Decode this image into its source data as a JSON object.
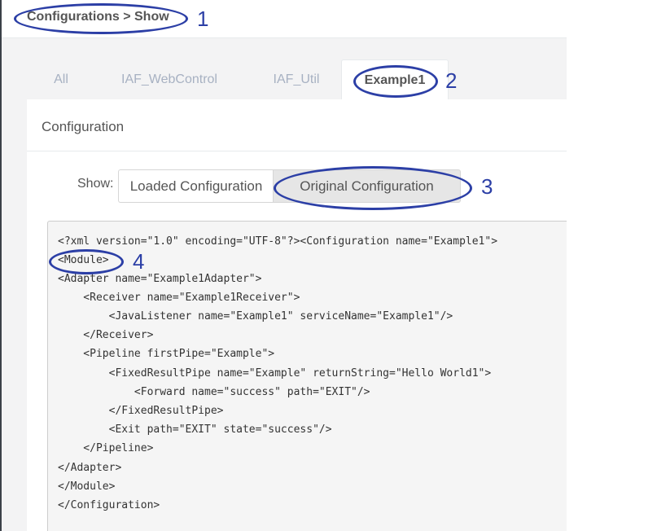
{
  "breadcrumb": "Configurations > Show",
  "tabs": [
    "All",
    "IAF_WebControl",
    "IAF_Util",
    "Example1"
  ],
  "panel_title": "Configuration",
  "show_label": "Show:",
  "buttons": {
    "loaded": "Loaded Configuration",
    "original": "Original Configuration"
  },
  "code_lines": [
    "<?xml version=\"1.0\" encoding=\"UTF-8\"?><Configuration name=\"Example1\">",
    "<Module>",
    "<Adapter name=\"Example1Adapter\">",
    "    <Receiver name=\"Example1Receiver\">",
    "        <JavaListener name=\"Example1\" serviceName=\"Example1\"/>",
    "    </Receiver>",
    "    <Pipeline firstPipe=\"Example\">",
    "        <FixedResultPipe name=\"Example\" returnString=\"Hello World1\">",
    "            <Forward name=\"success\" path=\"EXIT\"/>",
    "        </FixedResultPipe>",
    "        <Exit path=\"EXIT\" state=\"success\"/>",
    "    </Pipeline>",
    "</Adapter>",
    "</Module>",
    "</Configuration>"
  ],
  "annotations": [
    "1",
    "2",
    "3",
    "4"
  ],
  "annotation_color": "#2c3fa6"
}
